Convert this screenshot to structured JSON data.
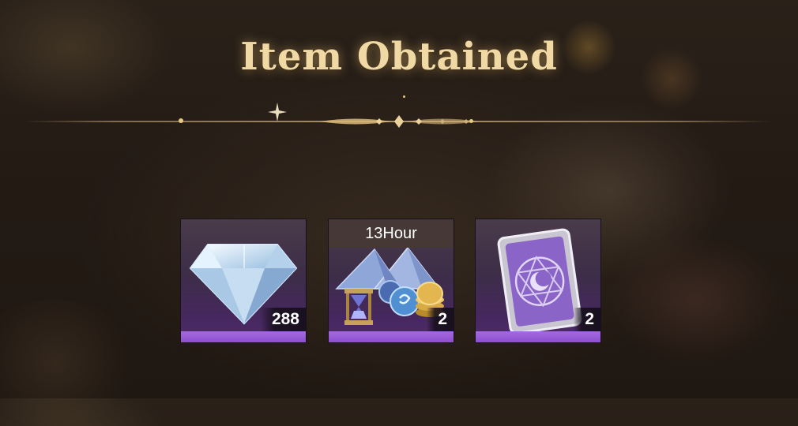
{
  "screen": {
    "title": "Item Obtained"
  },
  "items": [
    {
      "name": "diamond-gem",
      "icon": "diamond-icon",
      "timer": "",
      "quantity": "288",
      "rarity_color": "#9a5ee0"
    },
    {
      "name": "time-bundle",
      "icon": "time-bundle-icon",
      "timer": "13Hour",
      "quantity": "2",
      "rarity_color": "#9a5ee0"
    },
    {
      "name": "moon-card",
      "icon": "moon-card-icon",
      "timer": "",
      "quantity": "2",
      "rarity_color": "#9a5ee0"
    }
  ],
  "colors": {
    "title_gold": "#f0d9a4",
    "rarity_purple": "#9a5ee0",
    "background": "#241b15"
  }
}
